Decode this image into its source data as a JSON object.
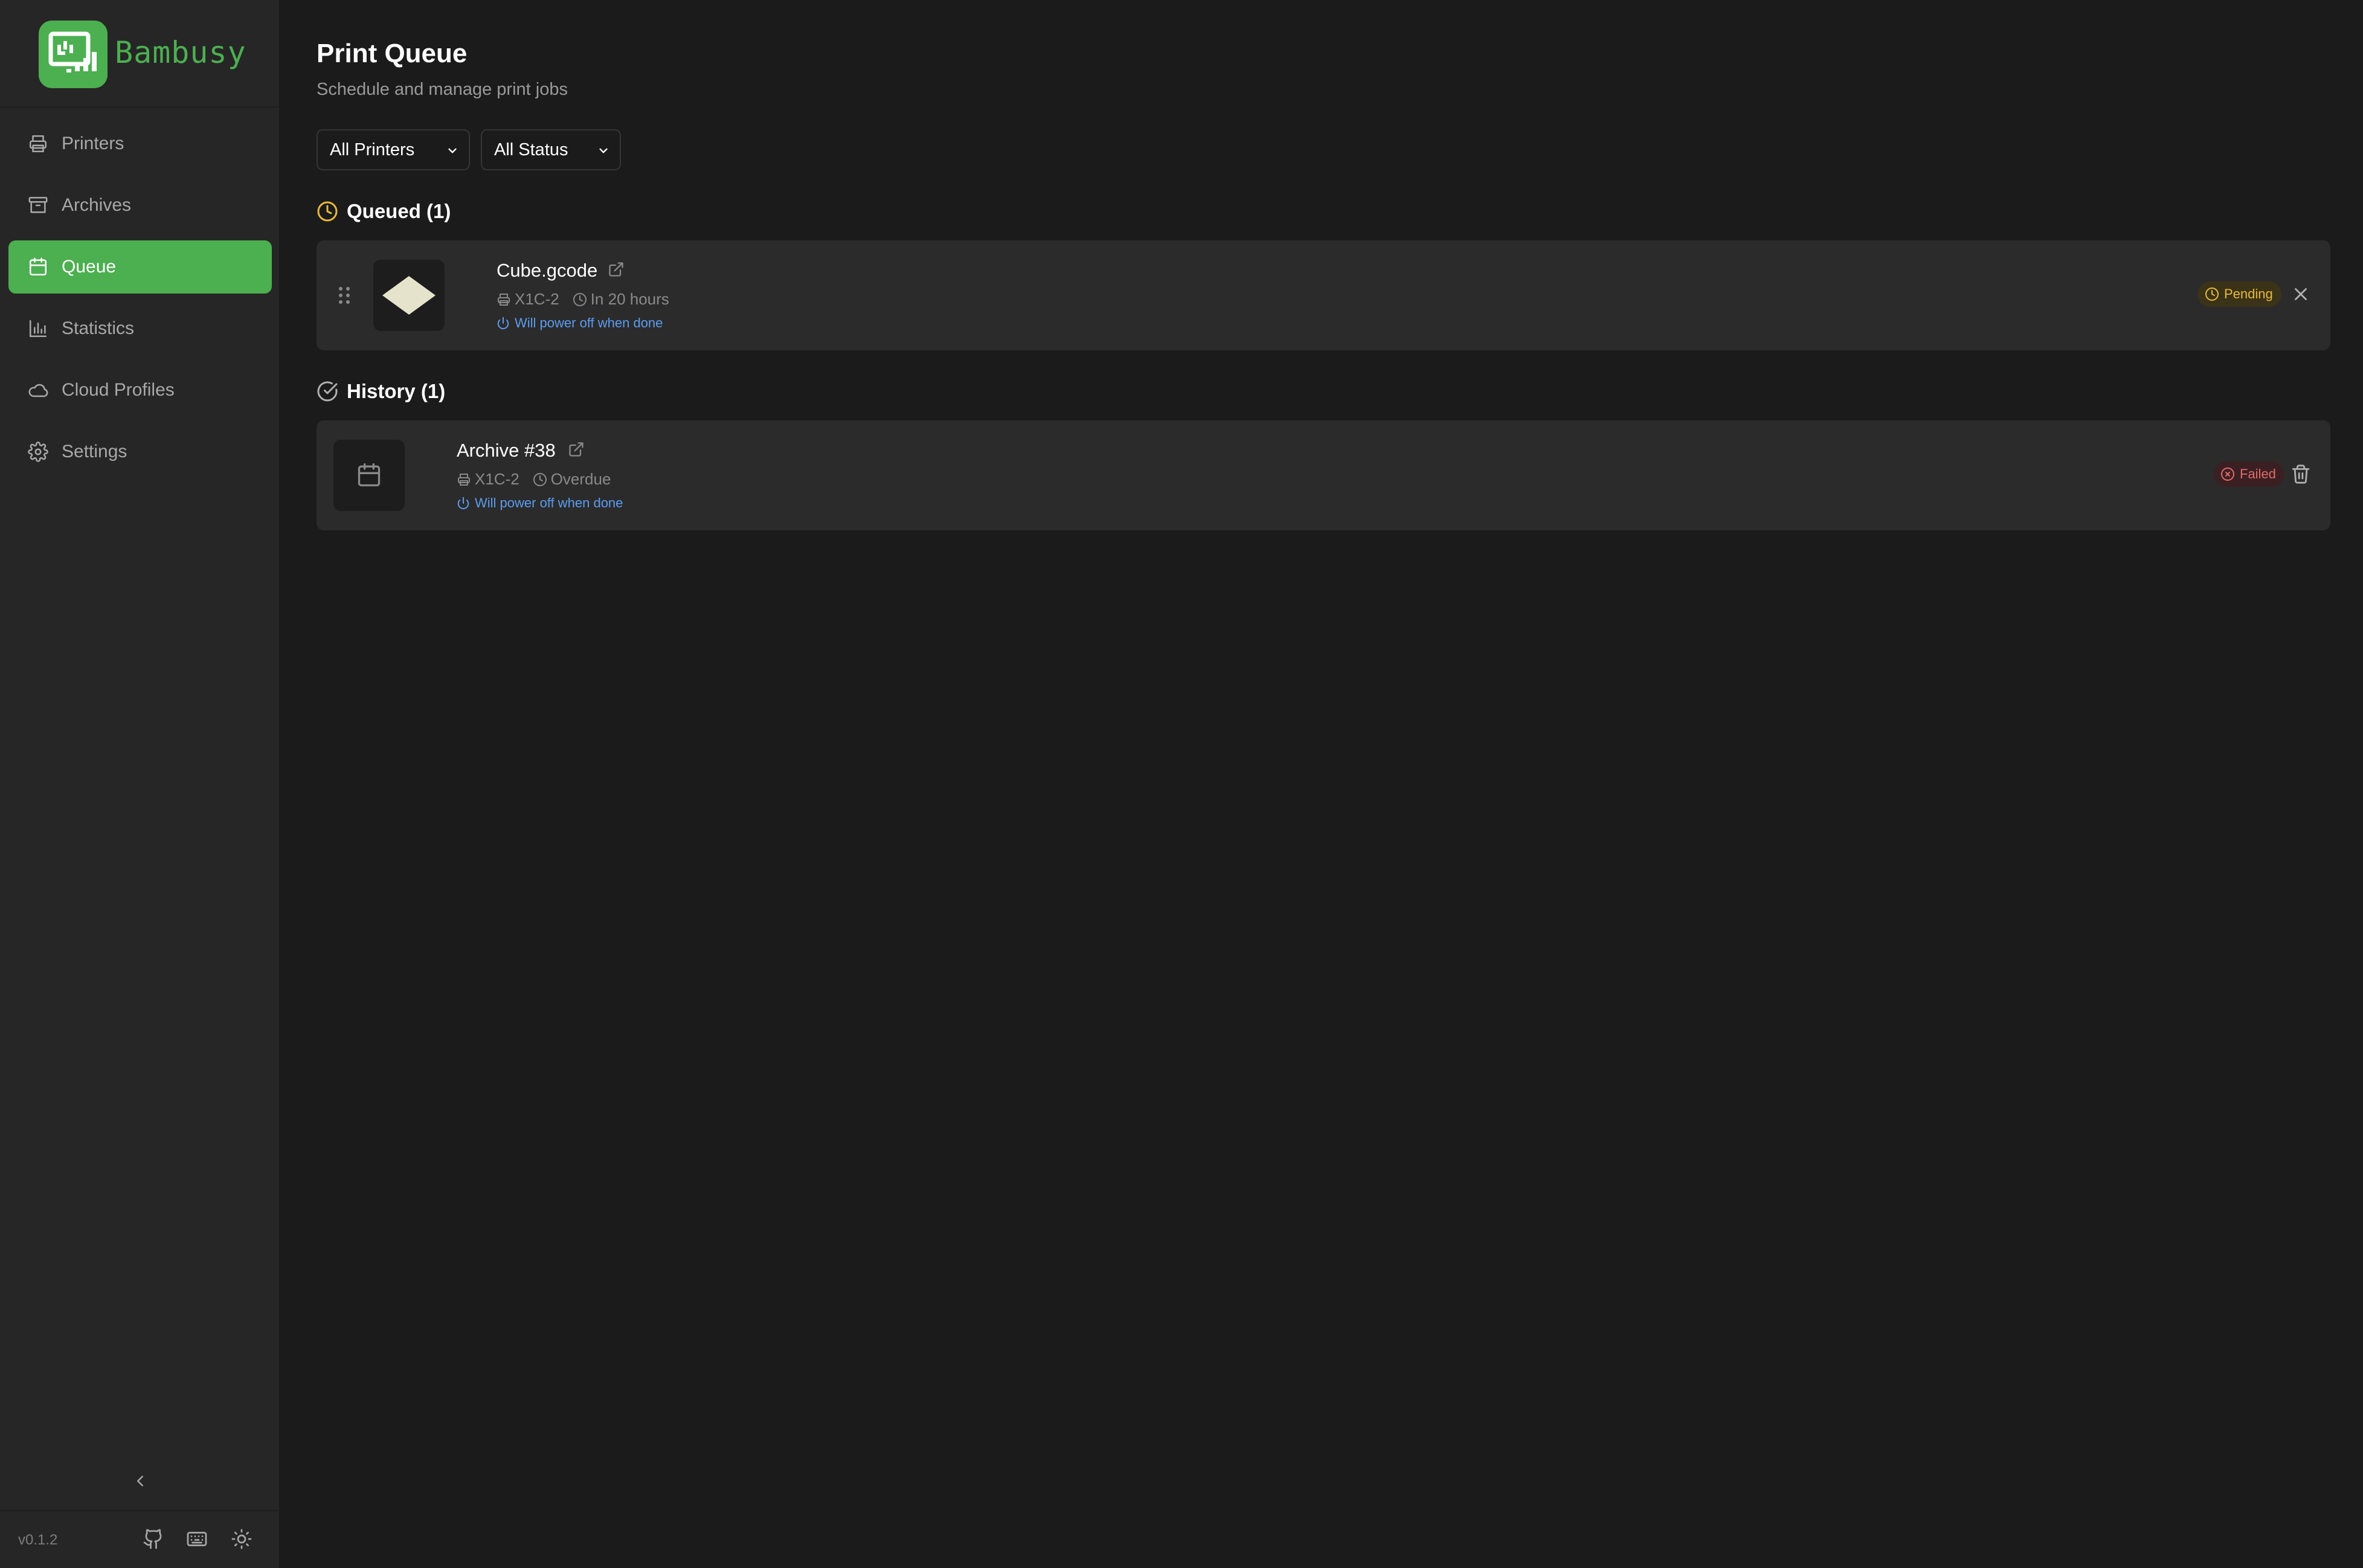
{
  "brand": {
    "name": "Bambusy",
    "accent": "#4caf50"
  },
  "sidebar": {
    "items": [
      {
        "label": "Printers",
        "icon": "printer-icon"
      },
      {
        "label": "Archives",
        "icon": "archive-icon"
      },
      {
        "label": "Queue",
        "icon": "calendar-icon",
        "active": true
      },
      {
        "label": "Statistics",
        "icon": "bar-chart-icon"
      },
      {
        "label": "Cloud Profiles",
        "icon": "cloud-icon"
      },
      {
        "label": "Settings",
        "icon": "gear-icon"
      }
    ],
    "version": "v0.1.2",
    "footer_icons": [
      "github-icon",
      "keyboard-icon",
      "sun-icon"
    ]
  },
  "page": {
    "title": "Print Queue",
    "subtitle": "Schedule and manage print jobs"
  },
  "filters": {
    "printers": "All Printers",
    "status": "All Status"
  },
  "queued": {
    "heading": "Queued (1)",
    "jobs": [
      {
        "name": "Cube.gcode",
        "printer": "X1C-2",
        "time": "In 20 hours",
        "power_note": "Will power off when done",
        "status": "Pending",
        "status_color": "#e9b93a"
      }
    ]
  },
  "history": {
    "heading": "History (1)",
    "jobs": [
      {
        "name": "Archive #38",
        "printer": "X1C-2",
        "time": "Overdue",
        "power_note": "Will power off when done",
        "status": "Failed",
        "status_color": "#e36a6a"
      }
    ]
  }
}
